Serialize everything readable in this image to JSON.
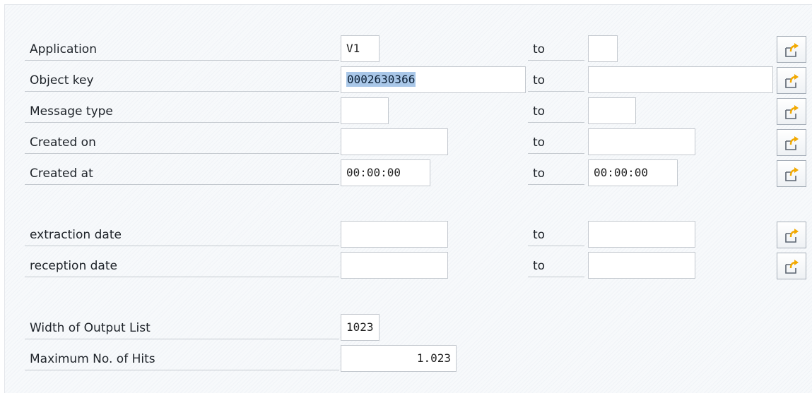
{
  "rows": [
    {
      "label": "Application",
      "from_value": "V1",
      "to_label": "to",
      "to_value": ""
    },
    {
      "label": "Object key",
      "from_value": "0002630366",
      "to_label": "to",
      "to_value": ""
    },
    {
      "label": "Message type",
      "from_value": "",
      "to_label": "to",
      "to_value": ""
    },
    {
      "label": "Created on",
      "from_value": "",
      "to_label": "to",
      "to_value": ""
    },
    {
      "label": "Created at",
      "from_value": "00:00:00",
      "to_label": "to",
      "to_value": "00:00:00"
    },
    {
      "label": "extraction date",
      "from_value": "",
      "to_label": "to",
      "to_value": ""
    },
    {
      "label": "reception date",
      "from_value": "",
      "to_label": "to",
      "to_value": ""
    },
    {
      "label": "Width of Output List",
      "value": "1023"
    },
    {
      "label": "Maximum No. of Hits",
      "value": "1.023"
    }
  ],
  "icons": {
    "multiple_selection": "multiple-selection-arrow-icon"
  },
  "colors": {
    "selection_highlight": "#a9c7e8",
    "icon_orange": "#f2a900",
    "icon_outline": "#5b6470"
  }
}
